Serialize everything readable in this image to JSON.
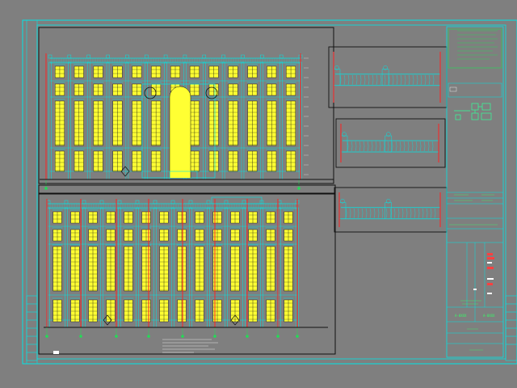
{
  "colors": {
    "background": "#7f7f7f",
    "frame": "#00e5e5",
    "outline": "#111111",
    "window_fill": "#ffff33",
    "column_red": "#ff2020",
    "grid_green": "#22dd55",
    "white": "#ffffff"
  },
  "drawing": {
    "sheet_type": "building elevation drawing sheet",
    "elevations": 2,
    "detail_views": 3,
    "upper_window_bays": 13,
    "lower_window_bays": 14
  },
  "title_block": {
    "drawing_number_a": "A-0XXX",
    "drawing_number_b": "A-0XXX"
  },
  "icons": {
    "legend": "diagram-legend-icon"
  }
}
